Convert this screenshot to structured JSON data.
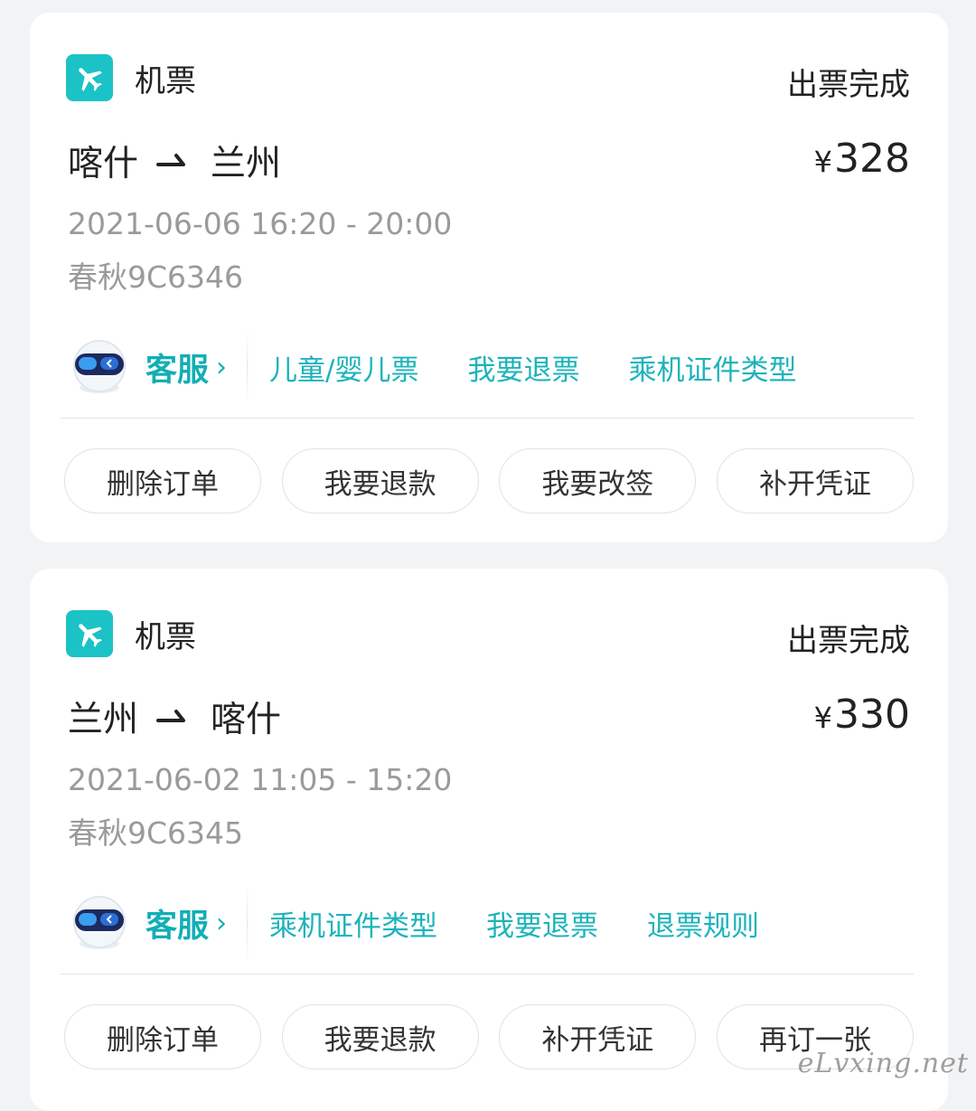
{
  "orders": [
    {
      "category": "机票",
      "status": "出票完成",
      "from": "喀什",
      "to": "兰州",
      "currency": "¥",
      "price": "328",
      "time": "2021-06-06 16:20 - 20:00",
      "flight": "春秋9C6346",
      "service_label": "客服",
      "quick_links": [
        "儿童/婴儿票",
        "我要退票",
        "乘机证件类型"
      ],
      "buttons": [
        "删除订单",
        "我要退款",
        "我要改签",
        "补开凭证"
      ]
    },
    {
      "category": "机票",
      "status": "出票完成",
      "from": "兰州",
      "to": "喀什",
      "currency": "¥",
      "price": "330",
      "time": "2021-06-02 11:05 - 15:20",
      "flight": "春秋9C6345",
      "service_label": "客服",
      "quick_links": [
        "乘机证件类型",
        "我要退票",
        "退票规则"
      ],
      "buttons": [
        "删除订单",
        "我要退款",
        "补开凭证",
        "再订一张"
      ]
    }
  ],
  "colors": {
    "accent": "#1cc3c6",
    "link": "#1db3bb",
    "muted": "#9a9a9a"
  },
  "icons": {
    "category": "airplane-icon",
    "route": "arrow-right-icon",
    "service": "robot-avatar-icon",
    "service_more": "chevron-right-icon"
  },
  "watermark": "eLvxing.net"
}
